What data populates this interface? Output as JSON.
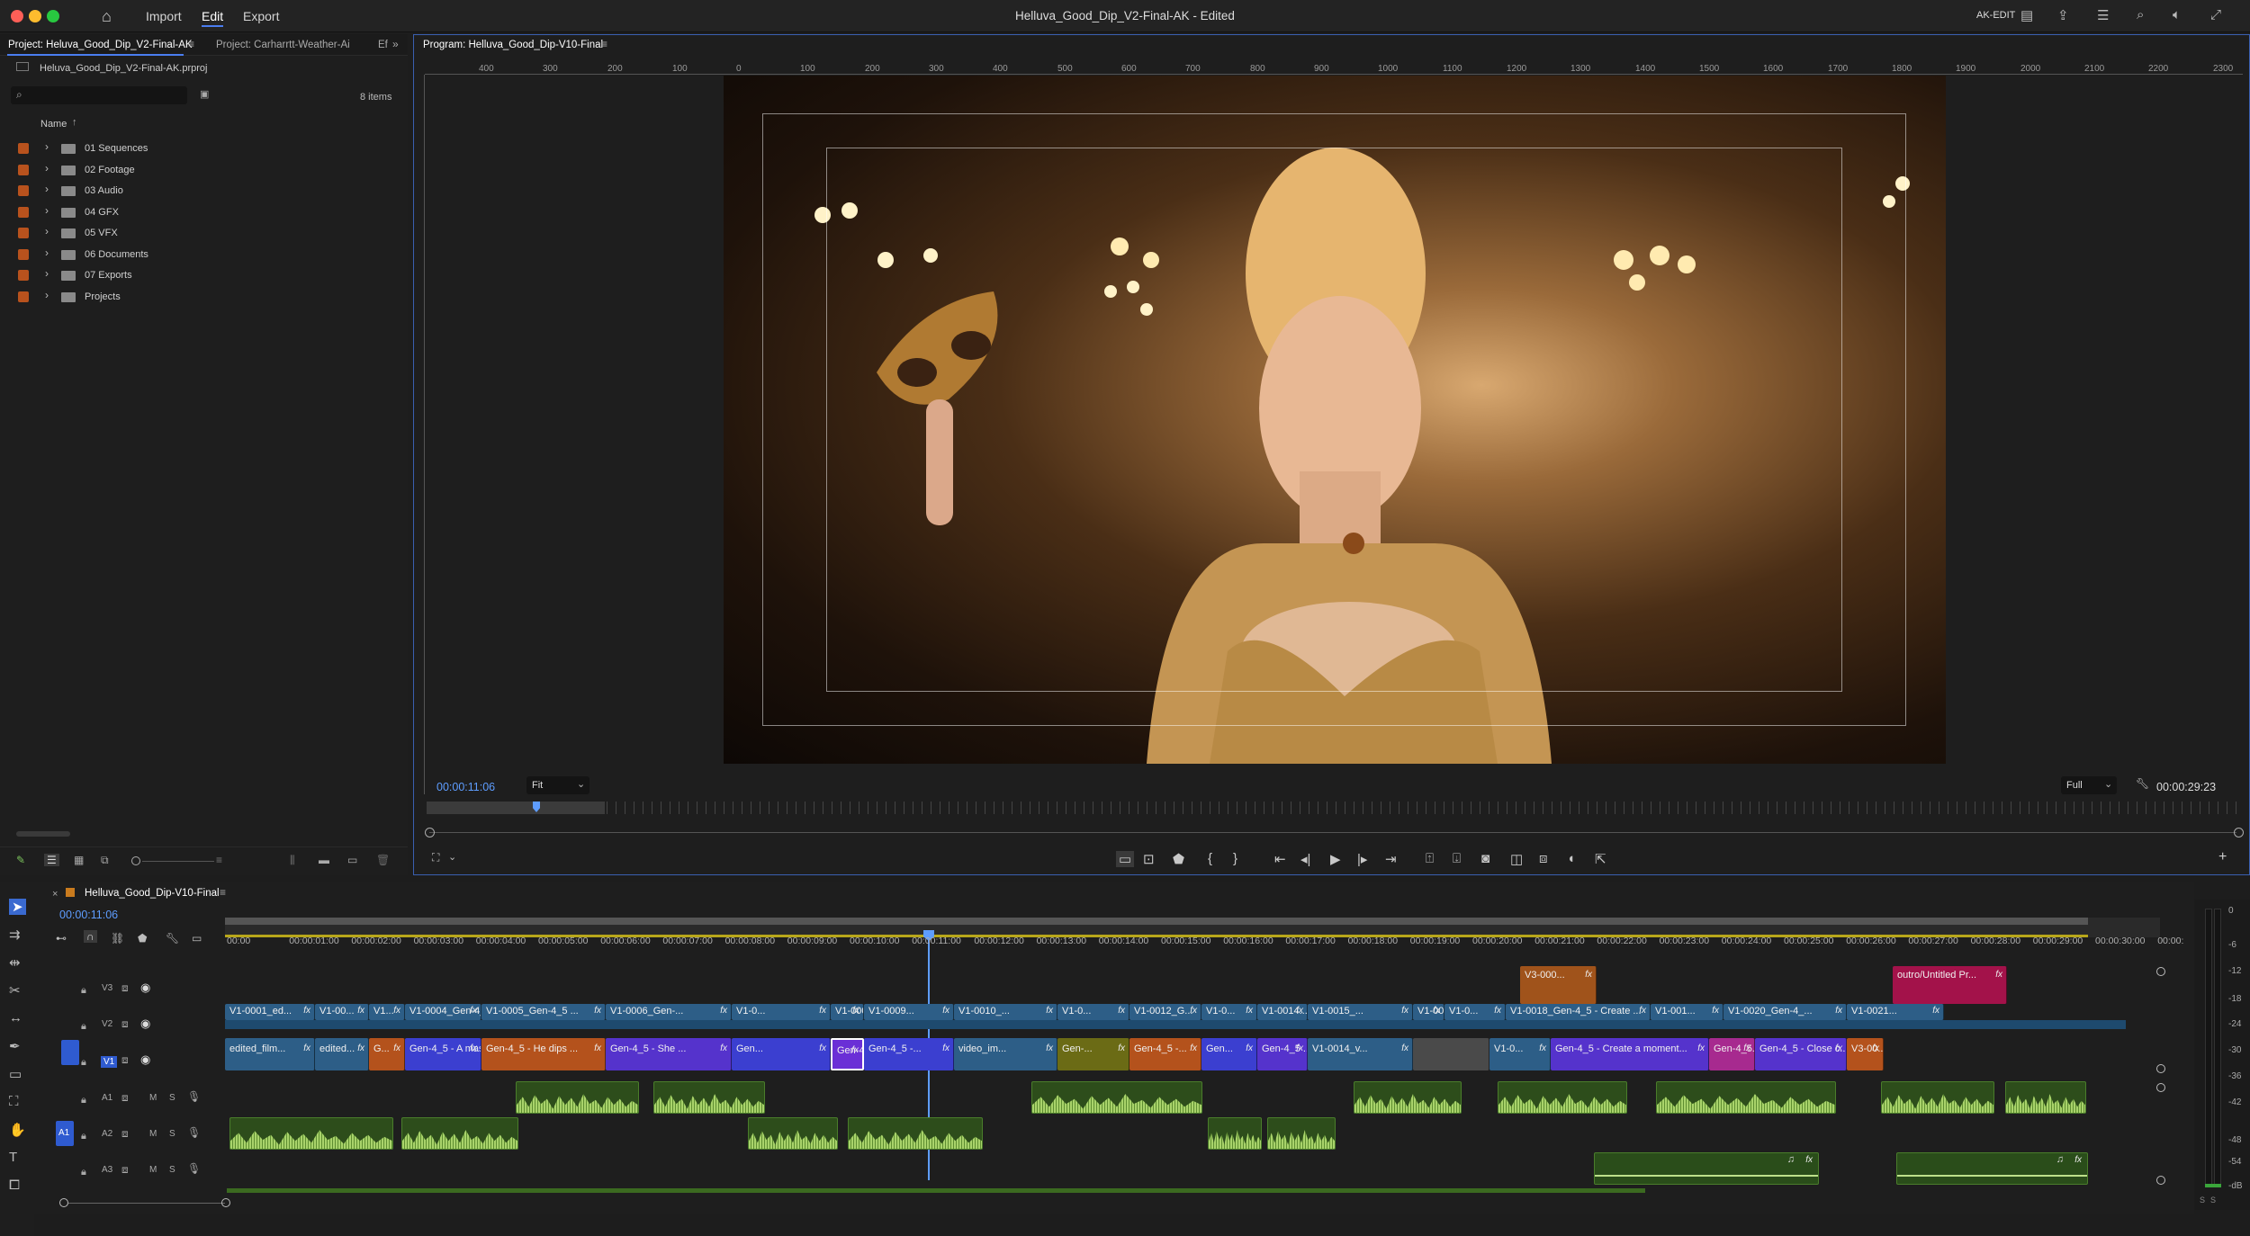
{
  "titlebar": {
    "title": "Helluva_Good_Dip_V2-Final-AK - Edited",
    "menu": [
      "Import",
      "Edit",
      "Export"
    ],
    "workspace_label": "AK-EDIT",
    "icons": [
      "home-icon",
      "workspace-icon",
      "share-icon",
      "quick-export-icon",
      "search-icon",
      "audio-icon",
      "fullscreen-icon"
    ]
  },
  "project_panel": {
    "tab_active": "Project: Heluva_Good_Dip_V2-Final-AK",
    "tab_inactive": "Project: Carharrtt-Weather-Ai",
    "tab_extra": "Ef",
    "project_file": "Heluva_Good_Dip_V2-Final-AK.prproj",
    "search_placeholder": "",
    "item_count": "8 items",
    "column_name": "Name",
    "bins": [
      "01 Sequences",
      "02 Footage",
      "03 Audio",
      "04 GFX",
      "05 VFX",
      "06 Documents",
      "07 Exports",
      "Projects"
    ]
  },
  "program_monitor": {
    "tab": "Program: Helluva_Good_Dip-V10-Final",
    "ruler_labels": [
      "400",
      "300",
      "200",
      "100",
      "0",
      "100",
      "200",
      "300",
      "400",
      "500",
      "600",
      "700",
      "800",
      "900",
      "1000",
      "1100",
      "1200",
      "1300",
      "1400",
      "1500",
      "1600",
      "1700",
      "1800",
      "1900",
      "2000",
      "2100",
      "2200",
      "2300"
    ],
    "timecode": "00:00:11:06",
    "fit": "Fit",
    "quality": "Full",
    "duration": "00:00:29:23"
  },
  "timeline": {
    "sequence_tab": "Helluva_Good_Dip-V10-Final",
    "timecode": "00:00:11:06",
    "ruler": [
      "00:00",
      "00:00:01:00",
      "00:00:02:00",
      "00:00:03:00",
      "00:00:04:00",
      "00:00:05:00",
      "00:00:06:00",
      "00:00:07:00",
      "00:00:08:00",
      "00:00:09:00",
      "00:00:10:00",
      "00:00:11:00",
      "00:00:12:00",
      "00:00:13:00",
      "00:00:14:00",
      "00:00:15:00",
      "00:00:16:00",
      "00:00:17:00",
      "00:00:18:00",
      "00:00:19:00",
      "00:00:20:00",
      "00:00:21:00",
      "00:00:22:00",
      "00:00:23:00",
      "00:00:24:00",
      "00:00:25:00",
      "00:00:26:00",
      "00:00:27:00",
      "00:00:28:00",
      "00:00:29:00",
      "00:00:30:00",
      "00:00:"
    ],
    "tracks": {
      "v3": "V3",
      "v2": "V2",
      "v1": "V1",
      "a1": "A1",
      "a2": "A2",
      "a3": "A3",
      "mute": "M",
      "solo": "S"
    },
    "v3_clips": [
      {
        "label": "V3-000...",
        "color": "#a0531b"
      },
      {
        "label": "outro/Untitled Pr...",
        "color": "#a3124a"
      }
    ],
    "v2_clips": [
      "V1-0001_ed...",
      "V1-00...",
      "V1...",
      "V1-0004_Gen-4_5 -...",
      "V1-0005_Gen-4_5 ...",
      "V1-0006_Gen-...",
      "V1-0...",
      "V1-0008_Gen...",
      "V1-0009...",
      "V1-0010_...",
      "V1-0...",
      "V1-0012_G...",
      "V1-0...",
      "V1-0014...",
      "V1-0015_...",
      "V1-001...",
      "V1-0...",
      "V1-0018_Gen-4_5 - Create ...",
      "V1-001...",
      "V1-0020_Gen-4_...",
      "V1-0021..."
    ],
    "v1_clips": [
      {
        "label": "edited_film...",
        "color": "#2d5e87"
      },
      {
        "label": "edited...",
        "color": "#2d5e87"
      },
      {
        "label": "G...",
        "color": "#b4521c"
      },
      {
        "label": "Gen-4_5 - A masked...",
        "color": "#3b3fd0"
      },
      {
        "label": "Gen-4_5 - He dips ...",
        "color": "#b4521c"
      },
      {
        "label": "Gen-4_5 - She ...",
        "color": "#5533cc"
      },
      {
        "label": "Gen...",
        "color": "#3b3fd0"
      },
      {
        "label": "Gen-4_5 - She...",
        "color": "#6a2fd6"
      },
      {
        "label": "Gen-4_5 -...",
        "color": "#3b3fd0"
      },
      {
        "label": "video_im...",
        "color": "#2d5e87"
      },
      {
        "label": "Gen-...",
        "color": "#6b6b15"
      },
      {
        "label": "Gen-4_5 -...",
        "color": "#b4521c"
      },
      {
        "label": "Gen...",
        "color": "#3b3fd0"
      },
      {
        "label": "Gen-4_5 ...",
        "color": "#5533cc"
      },
      {
        "label": "V1-0014_v...",
        "color": "#2d5e87"
      },
      {
        "label": "",
        "color": "#4a4a4a"
      },
      {
        "label": "V1-0...",
        "color": "#2d5e87"
      },
      {
        "label": "Gen-4_5 - Create a moment...",
        "color": "#5533cc"
      },
      {
        "label": "Gen-4_5...",
        "color": "#a72a8f"
      },
      {
        "label": "Gen-4_5 - Close c...",
        "color": "#5533cc"
      },
      {
        "label": "V3-00...",
        "color": "#b4521c"
      }
    ],
    "fx_label": "fx",
    "audio_clip_num": "1"
  },
  "meter": {
    "labels": [
      "0",
      "-6",
      "-12",
      "-18",
      "-24",
      "-30",
      "-36",
      "-42",
      "-48",
      "-54",
      "-dB"
    ],
    "solo_labels": [
      "S",
      "S"
    ]
  }
}
